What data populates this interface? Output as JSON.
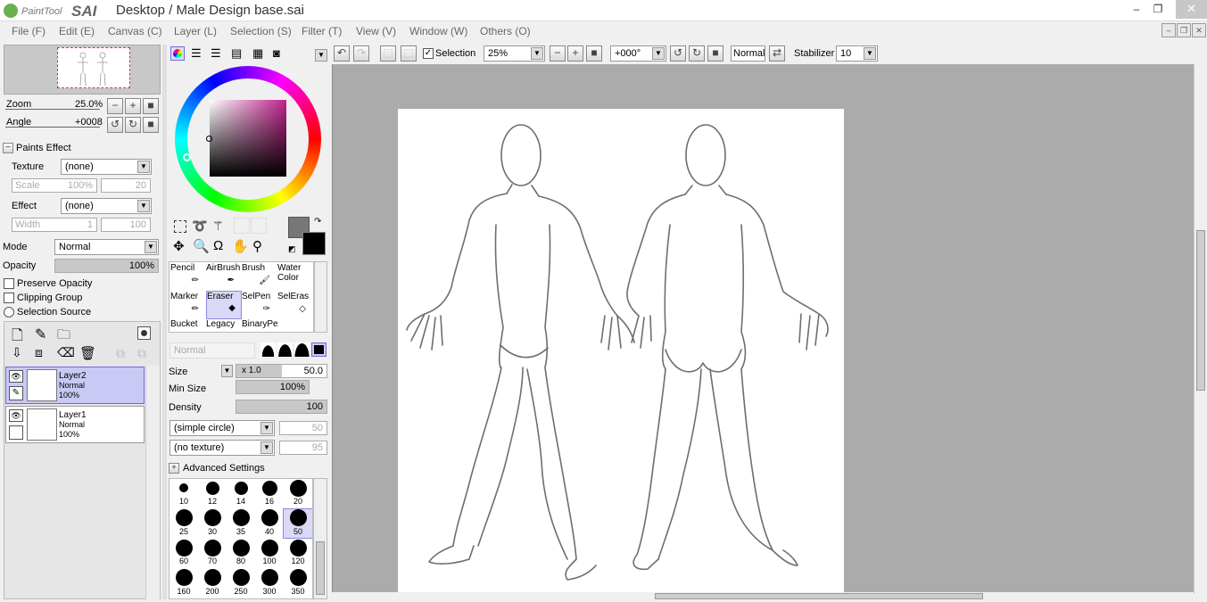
{
  "app": {
    "logo_text": "PaintTool SAI",
    "title": "Desktop / Male Design base.sai"
  },
  "window_buttons": {
    "minimize": "–",
    "restore": "❐",
    "close": "✕"
  },
  "menu": [
    "File (F)",
    "Edit (E)",
    "Canvas (C)",
    "Layer (L)",
    "Selection (S)",
    "Filter (T)",
    "View (V)",
    "Window (W)",
    "Others (O)"
  ],
  "navigator": {
    "zoom_label": "Zoom",
    "zoom_value": "25.0%",
    "angle_label": "Angle",
    "angle_value": "+0008"
  },
  "paints_effect": {
    "header": "Paints Effect",
    "texture_label": "Texture",
    "texture_value": "(none)",
    "scale_label": "Scale",
    "scale_value": "100%",
    "scale_num": "20",
    "effect_label": "Effect",
    "effect_value": "(none)",
    "width_label": "Width",
    "width_value": "1",
    "width_num": "100"
  },
  "layer_props": {
    "mode_label": "Mode",
    "mode_value": "Normal",
    "opacity_label": "Opacity",
    "opacity_value": "100%",
    "preserve_opacity": "Preserve Opacity",
    "clipping_group": "Clipping Group",
    "selection_source": "Selection Source"
  },
  "layers": [
    {
      "name": "Layer2",
      "mode": "Normal",
      "opacity": "100%",
      "selected": true
    },
    {
      "name": "Layer1",
      "mode": "Normal",
      "opacity": "100%",
      "selected": false
    }
  ],
  "tools": [
    {
      "name": "Pencil"
    },
    {
      "name": "AirBrush"
    },
    {
      "name": "Brush"
    },
    {
      "name": "Water Color"
    },
    {
      "name": "Marker"
    },
    {
      "name": "Eraser"
    },
    {
      "name": "SelPen"
    },
    {
      "name": "SelEras"
    },
    {
      "name": "Bucket"
    },
    {
      "name": "Legacy"
    },
    {
      "name": "BinaryPe"
    }
  ],
  "brush_settings": {
    "blend_mode": "Normal",
    "size_label": "Size",
    "size_mult": "x 1.0",
    "size_value": "50.0",
    "min_size_label": "Min Size",
    "min_size_value": "100%",
    "density_label": "Density",
    "density_value": "100",
    "shape": "(simple circle)",
    "shape_num": "50",
    "texture": "(no texture)",
    "texture_num": "95",
    "advanced": "Advanced Settings"
  },
  "brush_sizes": [
    "10",
    "12",
    "14",
    "16",
    "20",
    "25",
    "30",
    "35",
    "40",
    "50",
    "60",
    "70",
    "80",
    "100",
    "120",
    "160",
    "200",
    "250",
    "300",
    "350"
  ],
  "selected_brush_size": "50",
  "toolbar": {
    "selection_label": "Selection",
    "zoom_value": "25%",
    "angle_value": "+000°",
    "blend_value": "Normal",
    "stabilizer_label": "Stabilizer",
    "stabilizer_value": "10"
  }
}
